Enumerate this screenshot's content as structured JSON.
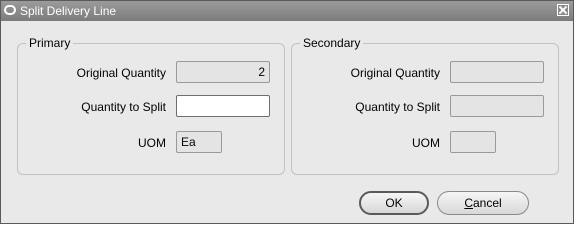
{
  "window": {
    "title": "Split Delivery Line"
  },
  "primary": {
    "title": "Primary",
    "original_quantity_label": "Original Quantity",
    "original_quantity_value": "2",
    "quantity_to_split_label": "Quantity to Split",
    "quantity_to_split_value": "",
    "uom_label": "UOM",
    "uom_value": "Ea"
  },
  "secondary": {
    "title": "Secondary",
    "original_quantity_label": "Original Quantity",
    "original_quantity_value": "",
    "quantity_to_split_label": "Quantity to Split",
    "quantity_to_split_value": "",
    "uom_label": "UOM",
    "uom_value": ""
  },
  "buttons": {
    "ok_label": "OK",
    "cancel_label": "Cancel"
  },
  "icons": {
    "title_icon": "oracle-icon",
    "close_icon": "close-icon"
  }
}
